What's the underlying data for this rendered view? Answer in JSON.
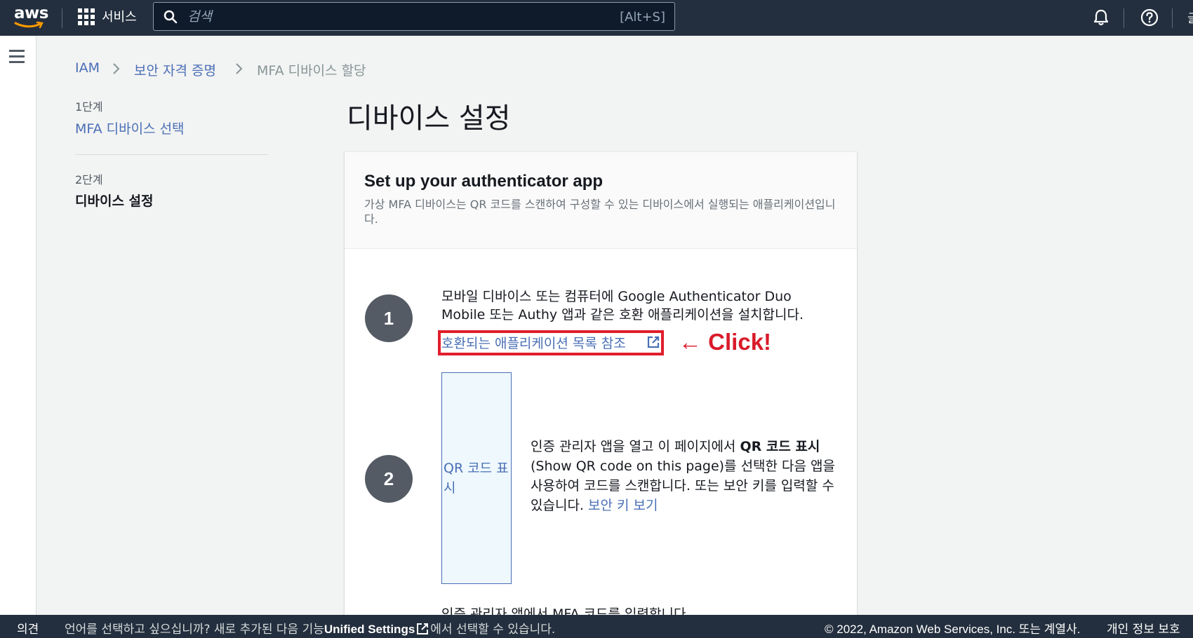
{
  "topnav": {
    "logo_text": "aws",
    "services_label": "서비스",
    "search_placeholder": "검색",
    "search_shortcut": "[Alt+S]",
    "edge_text": "글"
  },
  "breadcrumb": {
    "items": [
      "IAM",
      "보안 자격 증명",
      "MFA 디바이스 할당"
    ]
  },
  "steps": [
    {
      "number": "1단계",
      "title": "MFA 디바이스 선택"
    },
    {
      "number": "2단계",
      "title": "디바이스 설정"
    }
  ],
  "page_title": "디바이스 설정",
  "card": {
    "title": "Set up your authenticator app",
    "description": "가상 MFA 디바이스는 QR 코드를 스캔하여 구성할 수 있는 디바이스에서 실행되는 애플리케이션입니다.",
    "step1": {
      "number": "1",
      "text": "모바일 디바이스 또는 컴퓨터에 Google Authenticator Duo Mobile 또는 Authy 앱과 같은 호환 애플리케이션을 설치합니다.",
      "link": "호환되는 애플리케이션 목록 참조",
      "annotation": "← Click!"
    },
    "step2": {
      "number": "2",
      "qr_label": "QR 코드 표시",
      "text_before": "인증 관리자 앱을 열고 이 페이지에서 ",
      "text_bold": "QR 코드 표시",
      "text_after": " (Show QR code on this page)를 선택한 다음 앱을 사용하여 코드를 스캔합니다. 또는 보안 키를 입력할 수 있습니다. ",
      "link": "보안 키 보기"
    },
    "step3": {
      "text": "인증 관리자 앱에서 MFA 코드를 입력합니다."
    }
  },
  "footer": {
    "feedback": "의견",
    "lang_before": "언어를 선택하고 싶으십니까? 새로 추가된 다음 기능",
    "lang_link": "Unified Settings",
    "lang_after": "에서 선택할 수 있습니다.",
    "copyright": "© 2022, Amazon Web Services, Inc. 또는 계열사.",
    "privacy": "개인 정보 보호"
  },
  "colors": {
    "nav_bg": "#232f3e",
    "link": "#4a6fb5",
    "highlight": "#e01e2b",
    "step_circle": "#545b64"
  }
}
